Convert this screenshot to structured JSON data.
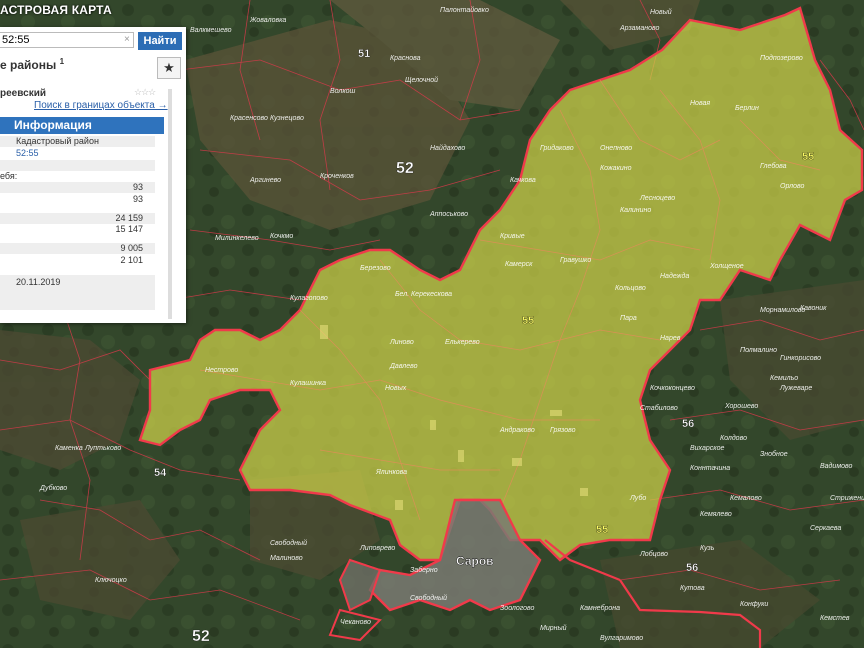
{
  "app": {
    "title": "АСТРОВАЯ КАРТА"
  },
  "search": {
    "value": "52:55",
    "clear": "×",
    "button": "Найти"
  },
  "layer": {
    "title": "е районы",
    "footnote": "1"
  },
  "star": "★",
  "object": {
    "name": "реевский",
    "rating": "☆☆☆",
    "find_link": "Поиск в границах объекта →"
  },
  "info_tab": {
    "label": "Информация"
  },
  "info_rows": [
    {
      "label": "Кадастровый район",
      "value": ""
    },
    {
      "label": "52:55",
      "value": ""
    },
    {
      "label": "ебя:",
      "value": ""
    },
    {
      "label": "",
      "value": "93"
    },
    {
      "label": "",
      "value": "93"
    },
    {
      "label": "",
      "value": "24 159"
    },
    {
      "label": "",
      "value": "15 147"
    },
    {
      "label": "",
      "value": "9 005"
    },
    {
      "label": "",
      "value": "2 101"
    },
    {
      "label": "20.11.2019",
      "value": ""
    }
  ],
  "map": {
    "colors": {
      "boundary": "#e8203a",
      "region_fill": "#cfd24a",
      "forest": "#33472b",
      "field": "#5c5a3a"
    },
    "region_labels": [
      "52",
      "51",
      "52",
      "54",
      "55",
      "55",
      "55",
      "55",
      "56",
      "56"
    ],
    "city": "Саров",
    "place_names": [
      "Арзаманово",
      "Жоваловка",
      "Палонтайовко",
      "Валкмешево",
      "Новый",
      "Краснова",
      "Щелочной",
      "Красенсово",
      "Кузнецово",
      "Волкош",
      "Найдахово",
      "Кроченков",
      "Подпозерово",
      "Берлин",
      "Новая",
      "Аргинево",
      "Аппоськово",
      "Милинкелево",
      "Кочкмо",
      "Качкова",
      "Кривые",
      "Камерск",
      "Гравушко",
      "Гридаково",
      "Кожакино",
      "Калинино",
      "Онепново",
      "Лесноцево",
      "Надежда",
      "Холщеное",
      "Глебова",
      "Бел. Керекескова",
      "Линово",
      "Елькерево",
      "Давлево",
      "Новых",
      "Андраково",
      "Грязово",
      "Ялинкова",
      "Березово",
      "Кулагопово",
      "Кулашинка",
      "Нестрово",
      "Пара",
      "Нарев",
      "Кольцово",
      "Орлово",
      "Морнамилово",
      "Кавоник",
      "Кочкоконцево",
      "Коннтачина",
      "Хорошево",
      "Полмалино",
      "Лужеваре",
      "Каменка",
      "Луптьково",
      "Дубково",
      "Ключоцко",
      "Свободный",
      "Малиново",
      "Липоврево",
      "Заберно",
      "Свободный",
      "Чеканово",
      "Вулгаримово",
      "Конфуки",
      "Кемялево",
      "Знобное",
      "Вадимово",
      "Серкаева",
      "Стабилово",
      "Вихарское",
      "Колдово",
      "Кемильо",
      "Гинкорисово",
      "Лобцово",
      "Лубо",
      "Кемалово",
      "Кузь",
      "Кутова",
      "Кемстев",
      "Зоологово",
      "Мирный",
      "Камнеброна",
      "Стриженица"
    ]
  }
}
